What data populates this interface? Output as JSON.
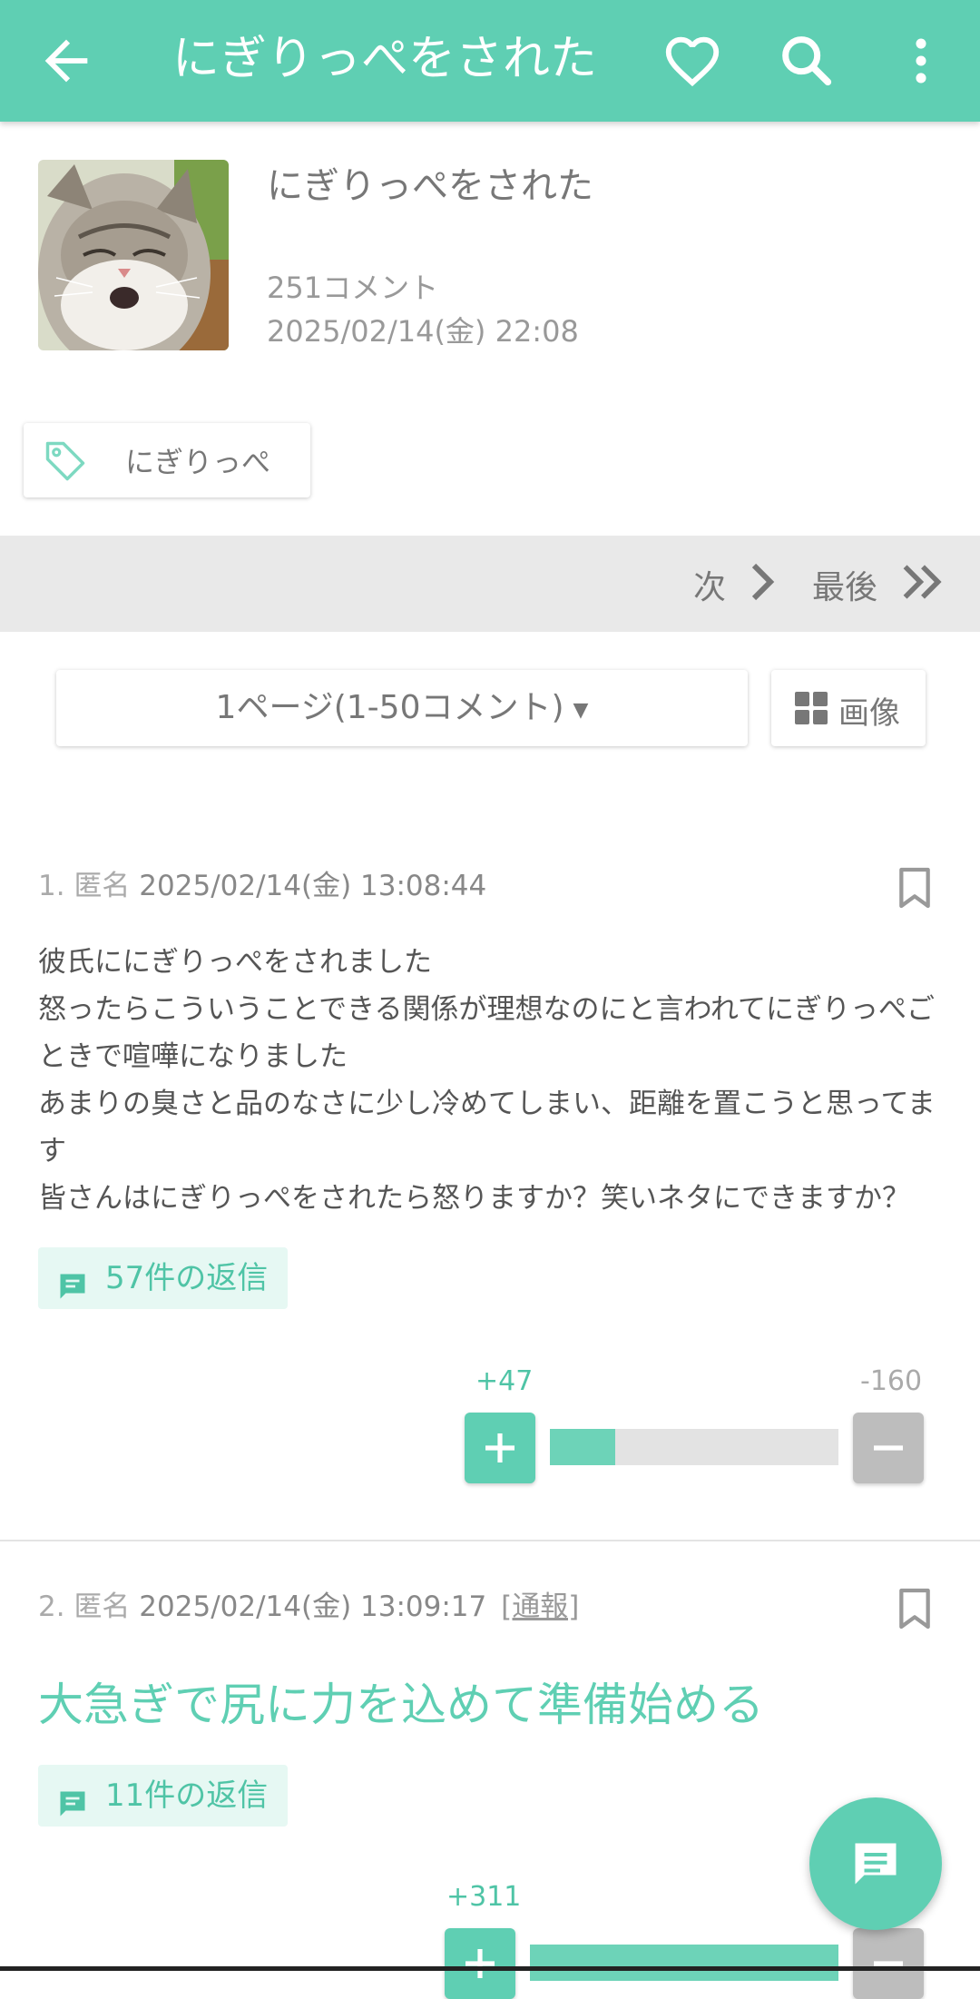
{
  "appbar": {
    "title": "にぎりっぺをされた",
    "icons": [
      "back-arrow-icon",
      "heart-icon",
      "search-icon",
      "more-vert-icon"
    ],
    "color": "#5fcfb3"
  },
  "post": {
    "title": "にぎりっぺをされた",
    "comment_count": "251コメント",
    "date": "2025/02/14(金) 22:08"
  },
  "tag": {
    "label": "にぎりっぺ"
  },
  "pager": {
    "next_label": "次",
    "last_label": "最後"
  },
  "page_select": {
    "label": "1ページ(1-50コメント)"
  },
  "image_button": {
    "label": "画像"
  },
  "comments": [
    {
      "number": "1.",
      "name": "匿名",
      "datetime": "2025/02/14(金) 13:08:44",
      "body": [
        "彼氏ににぎりっぺをされました",
        "怒ったらこういうことできる関係が理想なのにと言われてにぎりっぺごときで喧嘩になりました",
        "あまりの臭さと品のなさに少し冷めてしまい、距離を置こうと思ってます",
        "皆さんはにぎりっぺをされたら怒りますか？笑いネタにできますか？"
      ],
      "replies": "57件の返信",
      "plus": "+47",
      "minus": "-160",
      "plus_ratio": 0.227
    },
    {
      "number": "2.",
      "name": "匿名",
      "datetime": "2025/02/14(金) 13:09:17",
      "report": "[通報]",
      "body_big": "大急ぎで尻に力を込めて準備始める",
      "replies": "11件の返信",
      "plus": "+311"
    }
  ],
  "fab": {
    "icon": "comment-icon"
  }
}
